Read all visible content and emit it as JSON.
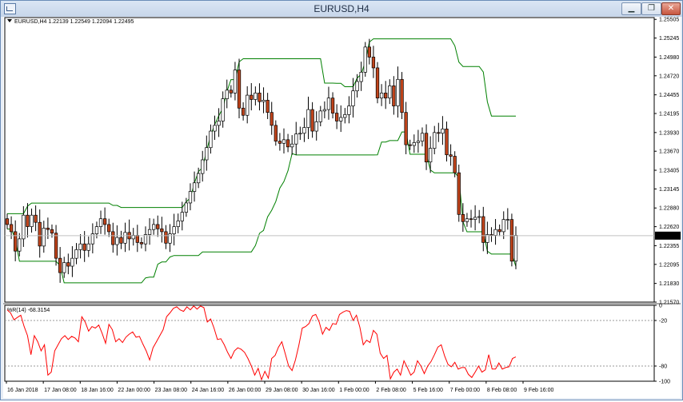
{
  "window": {
    "title": "EURUSD,H4",
    "min_icon": "minimize-icon",
    "max_icon": "restore-icon",
    "close_icon": "close-icon",
    "min_glyph": "▁",
    "max_glyph": "❐",
    "close_glyph": "✕"
  },
  "chart_data": [
    {
      "type": "candlestick",
      "title": "EURUSD,H4  1.22139 1.22549 1.22094 1.22495",
      "current_price_label": "1.22495",
      "ylim": [
        1.2157,
        1.2553
      ],
      "y_ticks": [
        "1.25505",
        "1.25245",
        "1.24980",
        "1.24720",
        "1.24455",
        "1.24195",
        "1.23930",
        "1.23670",
        "1.23405",
        "1.23145",
        "1.22880",
        "1.22620",
        "1.22355",
        "1.22095",
        "1.21830",
        "1.21570"
      ],
      "x_ticks": [
        "16 Jan 2018",
        "17 Jan 08:00",
        "18 Jan 16:00",
        "22 Jan 00:00",
        "23 Jan 08:00",
        "24 Jan 16:00",
        "26 Jan 00:00",
        "29 Jan 08:00",
        "30 Jan 16:00",
        "1 Feb 00:00",
        "2 Feb 08:00",
        "5 Feb 16:00",
        "7 Feb 00:00",
        "8 Feb 08:00",
        "9 Feb 16:00"
      ],
      "colors": {
        "bull": "#ffffff",
        "bear": "#c1441b",
        "wick": "#000000",
        "envelope": "#008000"
      },
      "close": [
        1.2265,
        1.2255,
        1.2228,
        1.2245,
        1.2278,
        1.2262,
        1.2278,
        1.2268,
        1.2235,
        1.226,
        1.2258,
        1.2253,
        1.2218,
        1.2198,
        1.2212,
        1.2207,
        1.2218,
        1.223,
        1.2238,
        1.2229,
        1.2238,
        1.2252,
        1.2262,
        1.2273,
        1.2265,
        1.2255,
        1.2237,
        1.2247,
        1.2239,
        1.2254,
        1.2245,
        1.225,
        1.224,
        1.2238,
        1.2251,
        1.2258,
        1.2265,
        1.2259,
        1.2255,
        1.2239,
        1.2252,
        1.2262,
        1.227,
        1.2282,
        1.2295,
        1.2311,
        1.2323,
        1.2336,
        1.2355,
        1.2372,
        1.2395,
        1.2403,
        1.2409,
        1.244,
        1.2452,
        1.2448,
        1.248,
        1.2427,
        1.2417,
        1.2445,
        1.2439,
        1.2448,
        1.2436,
        1.2438,
        1.2421,
        1.2403,
        1.2381,
        1.2378,
        1.2383,
        1.2373,
        1.2377,
        1.2391,
        1.2392,
        1.24,
        1.2425,
        1.2395,
        1.2408,
        1.2423,
        1.2425,
        1.2441,
        1.242,
        1.2409,
        1.2414,
        1.2418,
        1.243,
        1.2451,
        1.2464,
        1.2477,
        1.2512,
        1.2498,
        1.2483,
        1.2441,
        1.2448,
        1.2441,
        1.2458,
        1.243,
        1.2467,
        1.2421,
        1.2376,
        1.2375,
        1.2379,
        1.2381,
        1.2392,
        1.2352,
        1.2371,
        1.2393,
        1.2392,
        1.2398,
        1.2362,
        1.236,
        1.2337,
        1.2279,
        1.2269,
        1.2273,
        1.2272,
        1.2275,
        1.2276,
        1.224,
        1.2251,
        1.225,
        1.2258,
        1.2255,
        1.2272,
        1.2272,
        1.2214,
        1.225
      ]
    },
    {
      "type": "line",
      "title": "%R(14) -68.3154",
      "ylim": [
        -100,
        0
      ],
      "y_ticks": [
        "0",
        "-20",
        "-80",
        "-100"
      ],
      "levels": [
        -20,
        -80
      ],
      "series": [
        {
          "color": "#ff0000",
          "values": [
            -6,
            -10,
            -19,
            -16,
            -13,
            -28,
            -40,
            -65,
            -40,
            -48,
            -60,
            -52,
            -92,
            -88,
            -60,
            -52,
            -44,
            -40,
            -45,
            -41,
            -43,
            -48,
            -15,
            -22,
            -34,
            -28,
            -30,
            -26,
            -37,
            -50,
            -25,
            -32,
            -48,
            -44,
            -49,
            -42,
            -38,
            -35,
            -42,
            -41,
            -51,
            -60,
            -72,
            -56,
            -48,
            -40,
            -32,
            -15,
            -10,
            -4,
            -2,
            -6,
            -8,
            -2,
            -6,
            -1,
            -5,
            -1,
            -3,
            -22,
            -18,
            -30,
            -45,
            -44,
            -52,
            -62,
            -70,
            -60,
            -56,
            -58,
            -62,
            -70,
            -80,
            -92,
            -83,
            -98,
            -87,
            -96,
            -70,
            -66,
            -55,
            -48,
            -64,
            -80,
            -86,
            -72,
            -53,
            -30,
            -28,
            -24,
            -14,
            -12,
            -22,
            -38,
            -29,
            -33,
            -24,
            -25,
            -12,
            -9,
            -7,
            -8,
            -20,
            -13,
            -29,
            -52,
            -46,
            -49,
            -33,
            -38,
            -63,
            -70,
            -66,
            -97,
            -88,
            -84,
            -92,
            -73,
            -82,
            -92,
            -88,
            -73,
            -80,
            -90,
            -80,
            -74,
            -65,
            -55,
            -52,
            -67,
            -78,
            -81,
            -75,
            -84,
            -82,
            -82,
            -91,
            -95,
            -88,
            -80,
            -88,
            -85,
            -65,
            -84,
            -84,
            -76,
            -84,
            -82,
            -81,
            -70,
            -68
          ]
        }
      ]
    }
  ]
}
